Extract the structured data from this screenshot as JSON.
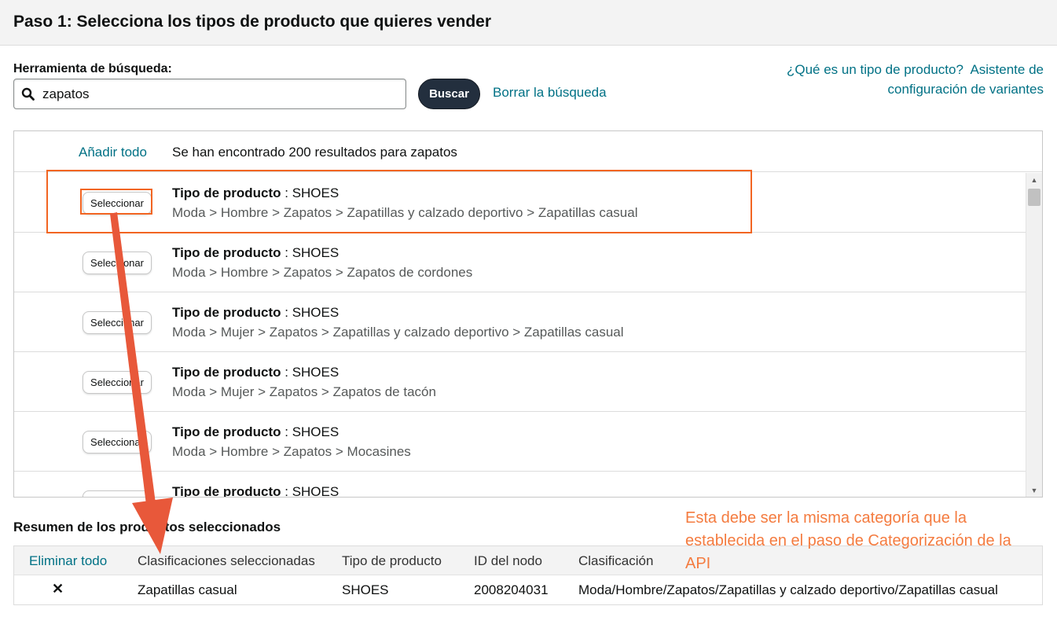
{
  "header": {
    "title": "Paso 1: Selecciona los tipos de producto que quieres vender"
  },
  "search": {
    "label": "Herramienta de búsqueda:",
    "value": "zapatos",
    "button_label": "Buscar",
    "clear_label": "Borrar la búsqueda"
  },
  "help": {
    "product_type_link": "¿Qué es un tipo de producto?",
    "variation_wizard_link": "Asistente de configuración de variantes"
  },
  "results": {
    "add_all_label": "Añadir todo",
    "count_text": "Se han encontrado 200 resultados para zapatos",
    "select_label": "Seleccionar",
    "type_label": "Tipo de producto",
    "items": [
      {
        "type": "SHOES",
        "path": "Moda > Hombre > Zapatos > Zapatillas y calzado deportivo > Zapatillas casual"
      },
      {
        "type": "SHOES",
        "path": "Moda > Hombre > Zapatos > Zapatos de cordones"
      },
      {
        "type": "SHOES",
        "path": "Moda > Mujer > Zapatos > Zapatillas y calzado deportivo > Zapatillas casual"
      },
      {
        "type": "SHOES",
        "path": "Moda > Mujer > Zapatos > Zapatos de tacón"
      },
      {
        "type": "SHOES",
        "path": "Moda > Hombre > Zapatos > Mocasines"
      },
      {
        "type": "SHOES",
        "path": ""
      }
    ]
  },
  "summary": {
    "title": "Resumen de los productos seleccionados",
    "remove_all_label": "Eliminar todo",
    "columns": {
      "classifications": "Clasificaciones seleccionadas",
      "product_type": "Tipo de producto",
      "node_id": "ID del nodo",
      "classification": "Clasificación"
    },
    "rows": [
      {
        "remove": "✕",
        "classifications": "Zapatillas casual",
        "product_type": "SHOES",
        "node_id": "2008204031",
        "classification": "Moda/Hombre/Zapatos/Zapatillas y calzado deportivo/Zapatillas casual"
      }
    ]
  },
  "annotation": {
    "text": "Esta debe ser la misma categoría que la establecida en el paso de Categorización de la API",
    "color": "#f47b3f"
  },
  "colors": {
    "link": "#007185",
    "highlight": "#f26522",
    "arrow": "#e8583a",
    "button_dark": "#232f3e"
  },
  "icons": {
    "search": "search-icon",
    "remove": "close-icon",
    "scroll_up": "scroll-up-arrow-icon",
    "scroll_down": "scroll-down-arrow-icon"
  }
}
